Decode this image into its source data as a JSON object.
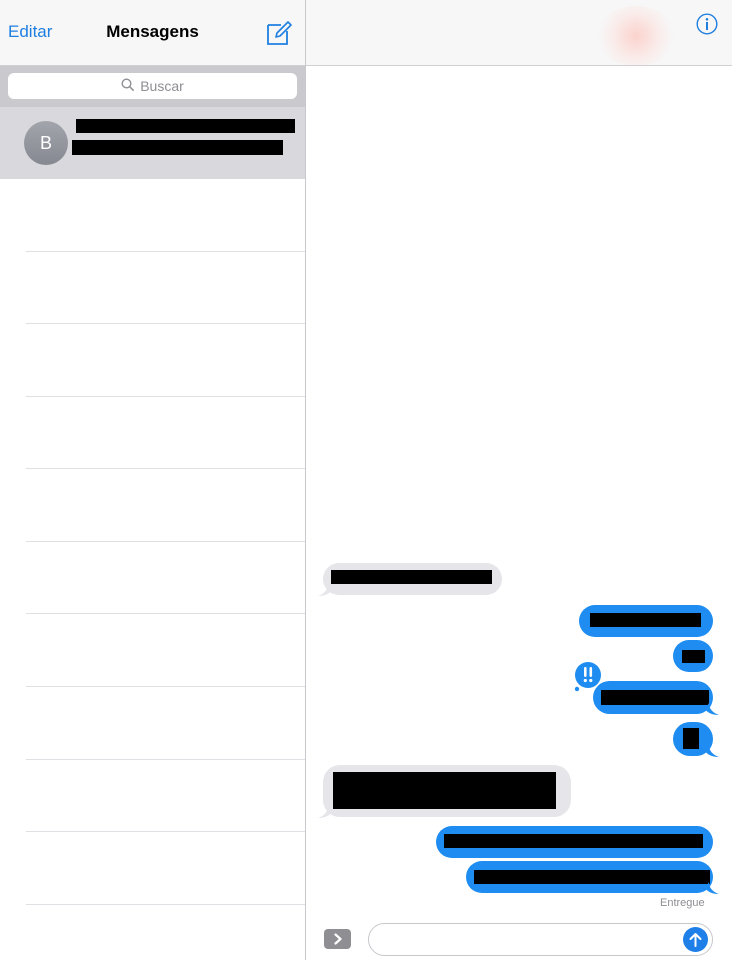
{
  "left_header": {
    "edit_label": "Editar",
    "title": "Mensagens"
  },
  "search": {
    "placeholder": "Buscar"
  },
  "conversations": [
    {
      "avatar_initial": "B"
    }
  ],
  "thread": {
    "status": "Entregue"
  },
  "icons": {
    "compose": "compose-icon",
    "info": "info-icon",
    "search": "search-icon",
    "effect": "invisible-ink-effect-icon",
    "apps": "chevron-right-icon",
    "send": "arrow-up-icon"
  },
  "colors": {
    "accent": "#1f7fe0",
    "outgoing_bubble": "#1e8cf0",
    "incoming_bubble": "#e5e5ea",
    "selected_row": "#d9d9dd"
  }
}
